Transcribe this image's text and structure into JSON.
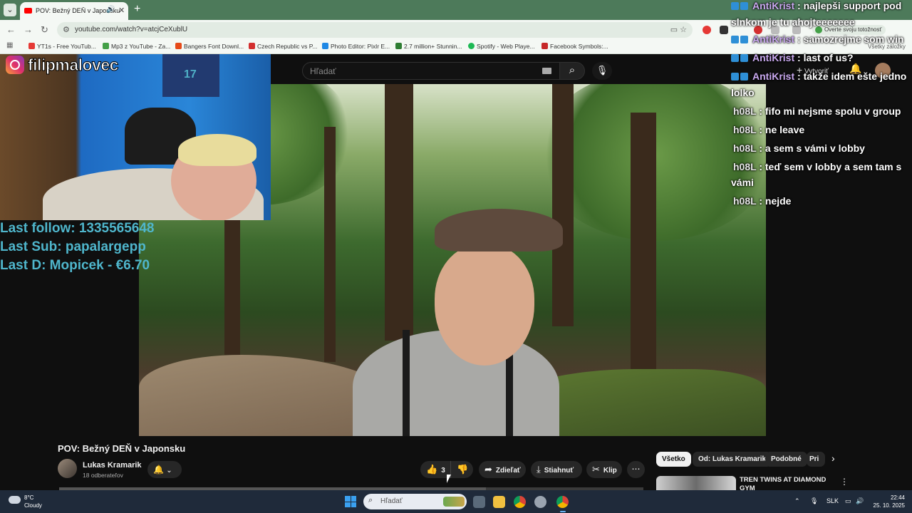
{
  "browser": {
    "tab_title": "POV: Bežný DEŇ v Japonsku",
    "url": "youtube.com/watch?v=atcjCeXublU",
    "verify_label": "Overte svoju totožnosť",
    "all_bookmarks": "Všetky záložky",
    "bookmarks": [
      {
        "label": "YT1s - Free YouTub...",
        "color": "#e53935"
      },
      {
        "label": "Mp3 z YouTube - Za...",
        "color": "#43a047"
      },
      {
        "label": "Bangers Font Downl...",
        "color": "#e64a19"
      },
      {
        "label": "Czech Republic vs P...",
        "color": "#d32f2f"
      },
      {
        "label": "Photo Editor: Pixlr E...",
        "color": "#1e88e5"
      },
      {
        "label": "2.7 million+ Stunnin...",
        "color": "#2e7d32"
      },
      {
        "label": "Spotify - Web Playe...",
        "color": "#1db954"
      },
      {
        "label": "Facebook Symbols:...",
        "color": "#c62828"
      }
    ]
  },
  "youtube": {
    "search_placeholder": "Hľadať",
    "create_label": "Vytvoriť",
    "video_title": "POV: Bežný DEŇ v Japonsku",
    "channel_name": "Lukas Kramarik",
    "subscribers": "18 odberateľov",
    "like_count": "3",
    "share_label": "Zdieľať",
    "download_label": "Stiahnuť",
    "clip_label": "Klip",
    "chips": [
      "Všetko",
      "Od: Lukas Kramarik",
      "Podobné",
      "Pri"
    ],
    "rec_title": "TREN TWINS AT DIAMOND GYM",
    "progress": 0.73
  },
  "stream_overlay": {
    "instagram": "filipmalovec",
    "jersey_number": "17",
    "stats": [
      "Last follow: 1335565648",
      "Last Sub: papalargepp",
      "Last D: Mopicek - €6.70"
    ],
    "chat": [
      {
        "user": "AntiKrist",
        "text": "najlepši support pod slnkom je tu ahojteeeeeee",
        "kind": "a"
      },
      {
        "user": "AntiKrist",
        "text": "samozrejme som win",
        "kind": "a"
      },
      {
        "user": "AntiKrist",
        "text": "last of us?",
        "kind": "a"
      },
      {
        "user": "AntiKrist",
        "text": "takže idem ešte jedno lolko",
        "kind": "a"
      },
      {
        "user": "h08L",
        "text": "fifo mi nejsme spolu v group",
        "kind": "h"
      },
      {
        "user": "h08L",
        "text": "ne leave",
        "kind": "h"
      },
      {
        "user": "h08L",
        "text": "a sem s vámi v lobby",
        "kind": "h"
      },
      {
        "user": "h08L",
        "text": "teď sem v lobby a sem tam s vámi",
        "kind": "h"
      },
      {
        "user": "h08L",
        "text": "nejde",
        "kind": "h"
      }
    ]
  },
  "taskbar": {
    "weather_temp": "8°C",
    "weather_desc": "Cloudy",
    "search_placeholder": "Hľadať",
    "language": "SLK",
    "time": "22:44",
    "date": "25. 10. 2025"
  },
  "colors": {
    "accent_teal": "#4fb6cc",
    "chat_user_a": "#caa9f0",
    "yt_bg": "#0f0f0f"
  }
}
